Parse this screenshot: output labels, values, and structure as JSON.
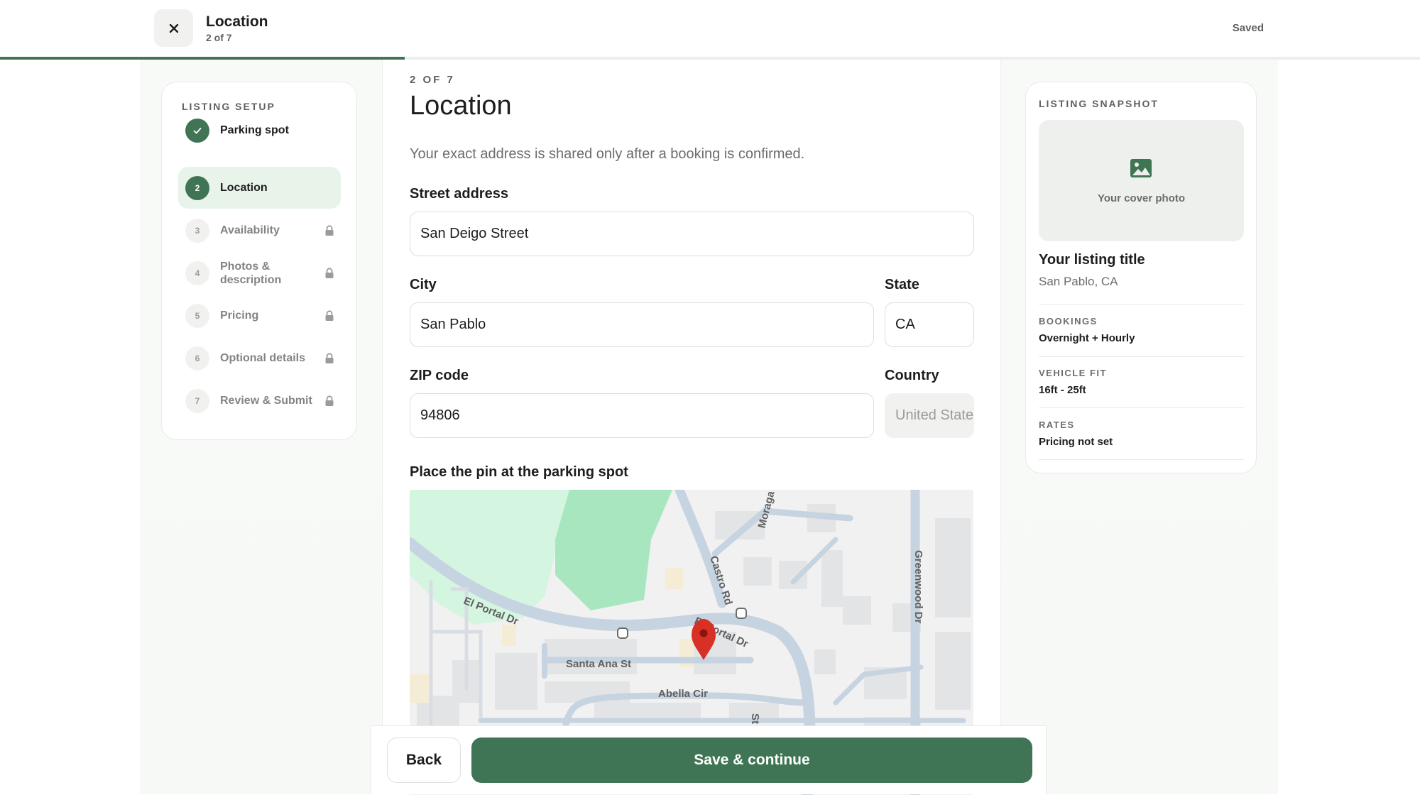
{
  "header": {
    "title": "Location",
    "subtitle": "2 of 7",
    "status": "Saved",
    "progress_fraction": 0.285
  },
  "sidebar": {
    "heading": "LISTING SETUP",
    "steps": [
      {
        "num": "",
        "label": "Parking spot",
        "state": "done"
      },
      {
        "num": "2",
        "label": "Location",
        "state": "current"
      },
      {
        "num": "3",
        "label": "Availability",
        "state": "locked"
      },
      {
        "num": "4",
        "label": "Photos & description",
        "state": "locked"
      },
      {
        "num": "5",
        "label": "Pricing",
        "state": "locked"
      },
      {
        "num": "6",
        "label": "Optional details",
        "state": "locked"
      },
      {
        "num": "7",
        "label": "Review & Submit",
        "state": "locked"
      }
    ]
  },
  "form": {
    "eyebrow": "2 OF 7",
    "title": "Location",
    "intro": "Your exact address is shared only after a booking is confirmed.",
    "street_label": "Street address",
    "street_value": "San Deigo Street",
    "city_label": "City",
    "city_value": "San Pablo",
    "state_label": "State",
    "state_value": "CA",
    "zip_label": "ZIP code",
    "zip_value": "94806",
    "country_label": "Country",
    "country_value": "United States",
    "map_label": "Place the pin at the parking spot",
    "map_streets": [
      "Moraga",
      "Castro Rd",
      "Greenwood Dr",
      "El Portal Dr",
      "El Portal Dr",
      "Santa Ana St",
      "Abella Cir",
      "St"
    ]
  },
  "actions": {
    "back": "Back",
    "save": "Save & continue"
  },
  "snapshot": {
    "heading": "LISTING SNAPSHOT",
    "cover_text": "Your cover photo",
    "title": "Your listing title",
    "location": "San Pablo, CA",
    "bookings_label": "BOOKINGS",
    "bookings_value": "Overnight + Hourly",
    "vehicle_label": "VEHICLE FIT",
    "vehicle_value": "16ft - 25ft",
    "rates_label": "RATES",
    "rates_value": "Pricing not set"
  },
  "colors": {
    "accent": "#3f7555",
    "active_bg": "#e8f3ea",
    "pin": "#d93025"
  }
}
